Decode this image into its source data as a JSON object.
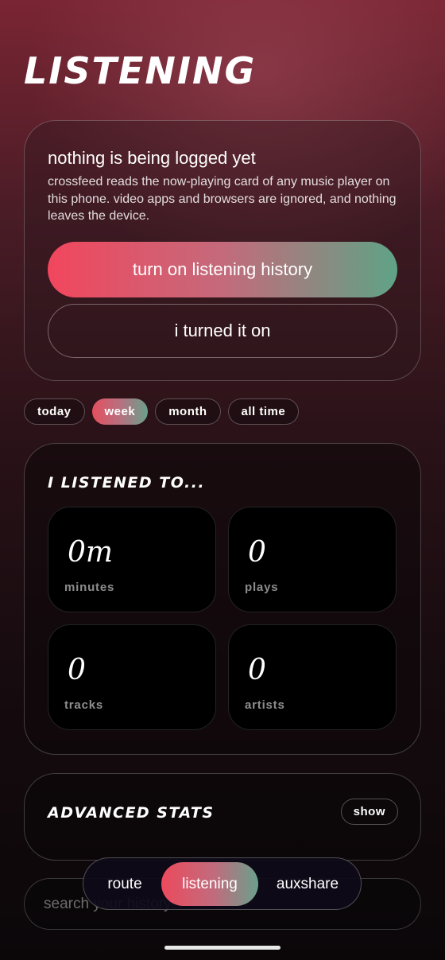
{
  "page": {
    "title": "LISTENING"
  },
  "intro": {
    "heading": "nothing is being logged yet",
    "body": "crossfeed reads the now-playing card of any music player on this phone. video apps and browsers are ignored, and nothing leaves the device.",
    "primary_button": "turn on listening history",
    "secondary_button": "i turned it on"
  },
  "time_ranges": {
    "items": [
      "today",
      "week",
      "month",
      "all time"
    ],
    "selected": "week"
  },
  "stats": {
    "heading": "I LISTENED TO...",
    "tiles": [
      {
        "value": "0m",
        "label": "minutes"
      },
      {
        "value": "0",
        "label": "plays"
      },
      {
        "value": "0",
        "label": "tracks"
      },
      {
        "value": "0",
        "label": "artists"
      }
    ]
  },
  "advanced": {
    "heading": "ADVANCED STATS",
    "toggle_label": "show"
  },
  "search": {
    "placeholder": "search your history"
  },
  "tabbar": {
    "tabs": [
      "route",
      "listening",
      "auxshare"
    ],
    "active": "listening"
  },
  "colors": {
    "accent_start": "#f2465d",
    "accent_end": "#5fa386",
    "background_top": "#7a2533",
    "background_bottom": "#0b0709"
  }
}
